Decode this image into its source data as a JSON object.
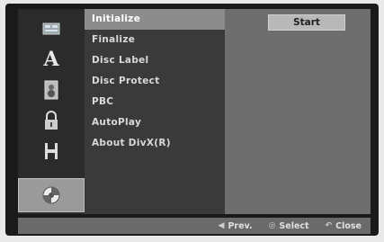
{
  "sidebar": {
    "items": [
      {
        "icon": "disc-menu-icon"
      },
      {
        "icon": "language-icon",
        "glyph": "A"
      },
      {
        "icon": "audio-speaker-icon"
      },
      {
        "icon": "lock-icon"
      },
      {
        "icon": "film-reel-icon"
      },
      {
        "icon": "disc-options-icon"
      }
    ],
    "active_index": 5
  },
  "menu": {
    "items": [
      {
        "label": "Initialize"
      },
      {
        "label": "Finalize"
      },
      {
        "label": "Disc Label"
      },
      {
        "label": "Disc Protect"
      },
      {
        "label": "PBC"
      },
      {
        "label": "AutoPlay"
      },
      {
        "label": "About DivX(R)"
      }
    ],
    "selected_index": 0
  },
  "panel": {
    "start_label": "Start"
  },
  "footer": {
    "prev_symbol": "◀",
    "prev_label": "Prev.",
    "select_symbol": "◎",
    "select_label": "Select",
    "close_symbol": "↶",
    "close_label": "Close"
  },
  "colors": {
    "background": "#1a1a1a",
    "sidebar": "#2b2b2b",
    "menu": "#3a3a3a",
    "panel": "#6e6e6e",
    "highlight": "#8c8c8c"
  }
}
